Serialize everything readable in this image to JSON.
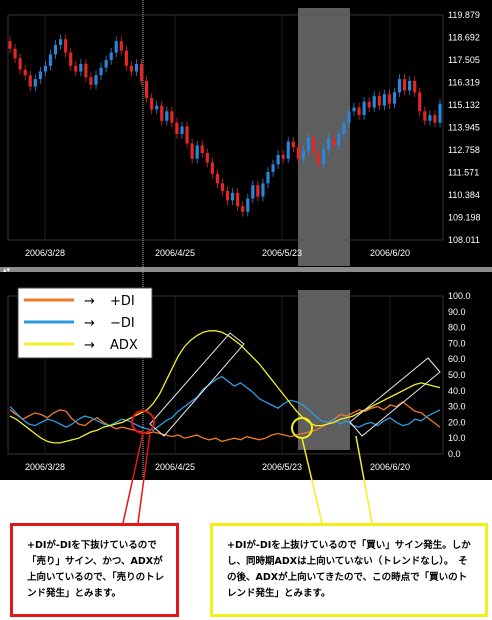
{
  "colors": {
    "background": "#000000",
    "axis_text": "#ffffff",
    "bull_candle": "#2a86d8",
    "bear_candle": "#e32626",
    "plus_di": "#f07a28",
    "minus_di": "#2d9be0",
    "adx": "#f2ee2a",
    "highlight_band": "#6e6e6e",
    "cursor_line": "#bbbbbb",
    "red_callout": "#e01818",
    "yellow_callout": "#f2ef1a"
  },
  "chart_data": [
    {
      "type": "candlestick",
      "ylim": [
        108.011,
        119.879
      ],
      "y_ticks": [
        "119.879",
        "118.692",
        "117.505",
        "116.319",
        "115.132",
        "113.945",
        "112.758",
        "111.571",
        "110.384",
        "109.198",
        "108.011"
      ],
      "x_ticks": [
        "2006/3/28",
        "2006/4/25",
        "2006/5/23",
        "2006/6/20"
      ],
      "close_values": [
        118.1,
        117.6,
        117.0,
        116.7,
        116.1,
        116.5,
        116.9,
        117.2,
        117.8,
        118.3,
        118.6,
        117.9,
        117.2,
        116.9,
        117.3,
        116.6,
        116.2,
        116.7,
        117.1,
        117.5,
        117.9,
        118.5,
        118.0,
        117.2,
        116.9,
        117.3,
        116.4,
        115.5,
        114.9,
        115.1,
        114.3,
        114.8,
        114.2,
        113.6,
        114.0,
        113.1,
        112.3,
        113.0,
        112.6,
        112.1,
        111.5,
        111.0,
        110.6,
        110.1,
        110.5,
        109.8,
        109.5,
        110.2,
        110.9,
        110.3,
        111.0,
        111.6,
        112.0,
        112.5,
        112.3,
        113.2,
        112.9,
        112.3,
        112.7,
        113.4,
        112.6,
        112.0,
        112.8,
        113.4,
        113.0,
        113.6,
        114.2,
        114.8,
        115.0,
        114.6,
        115.3,
        115.0,
        115.6,
        115.1,
        115.7,
        115.2,
        115.8,
        116.5,
        115.9,
        116.4,
        115.8,
        114.8,
        114.3,
        114.6,
        114.2,
        115.2
      ]
    },
    {
      "type": "line",
      "ylim": [
        0,
        100
      ],
      "y_ticks": [
        "100.0",
        "90.0",
        "80.0",
        "70.0",
        "60.0",
        "50.0",
        "40.0",
        "30.0",
        "20.0",
        "10.0",
        "0.0"
      ],
      "x_ticks": [
        "2006/3/28",
        "2006/4/25",
        "2006/5/23",
        "2006/6/20"
      ],
      "series": [
        {
          "name": "+DI",
          "values": [
            28,
            25,
            22,
            24,
            26,
            25,
            23,
            26,
            28,
            27,
            22,
            19,
            18,
            21,
            23,
            20,
            18,
            16,
            17,
            16,
            15,
            14,
            13,
            14,
            13,
            12,
            11,
            12,
            10,
            11,
            12,
            10,
            9,
            10,
            8,
            9,
            10,
            9,
            11,
            10,
            9,
            10,
            12,
            13,
            12,
            11,
            12,
            13,
            14,
            15,
            17,
            19,
            22,
            25,
            24,
            26,
            28,
            27,
            29,
            30,
            28,
            31,
            30,
            33,
            30,
            27,
            26,
            23,
            20,
            17
          ]
        },
        {
          "name": "−DI",
          "values": [
            30,
            26,
            22,
            19,
            18,
            20,
            22,
            21,
            19,
            17,
            19,
            22,
            24,
            23,
            21,
            19,
            18,
            20,
            22,
            21,
            19,
            17,
            16,
            15,
            18,
            21,
            23,
            27,
            30,
            33,
            36,
            41,
            44,
            47,
            49,
            46,
            43,
            45,
            42,
            39,
            35,
            33,
            31,
            29,
            32,
            34,
            33,
            31,
            28,
            24,
            21,
            20,
            22,
            19,
            21,
            18,
            17,
            19,
            20,
            18,
            21,
            23,
            20,
            18,
            19,
            22,
            21,
            24,
            26,
            28
          ]
        },
        {
          "name": "ADX",
          "values": [
            24,
            22,
            19,
            16,
            13,
            10,
            8,
            7,
            7,
            8,
            9,
            10,
            12,
            14,
            15,
            17,
            18,
            19,
            20,
            22,
            24,
            26,
            28,
            32,
            38,
            46,
            54,
            62,
            68,
            72,
            75,
            77,
            78,
            78,
            77,
            75,
            72,
            69,
            65,
            61,
            57,
            52,
            47,
            42,
            37,
            32,
            27,
            23,
            20,
            18,
            18,
            19,
            20,
            22,
            23,
            24,
            26,
            28,
            30,
            32,
            34,
            36,
            38,
            40,
            42,
            44,
            45,
            44,
            43,
            42
          ]
        }
      ]
    }
  ],
  "legend": [
    {
      "arrow": "→",
      "label": "+DI"
    },
    {
      "arrow": "→",
      "label": "−DI"
    },
    {
      "arrow": "→",
      "label": "ADX"
    }
  ],
  "callouts": {
    "red": "+DIが-DIを下抜けているので「売り」サイン、かつ、ADXが上向いているので、「売りのトレンド発生」とみます。",
    "yellow": "+DIが-DIを上抜けているので「買い」サイン発生。しかし、同時期ADXは上向いていない（トレンドなし）。　その後、ADXが上向いてきたので、この時点で「買いのトレンド発生」とみます。"
  }
}
